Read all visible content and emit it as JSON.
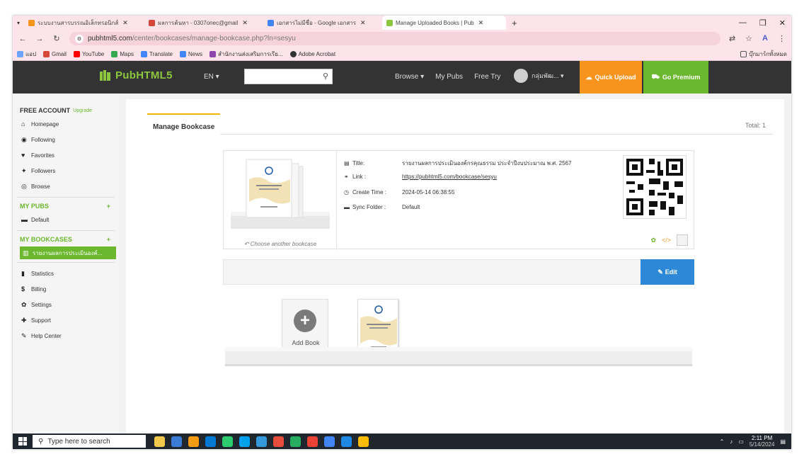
{
  "browser": {
    "tabs": [
      {
        "label": "ระบบงานสารบรรณอิเล็กทรอนิกส์",
        "color": "#f7941e"
      },
      {
        "label": "ผลการค้นหา - 0307onec@gmail",
        "color": "#d44638"
      },
      {
        "label": "เอกสารไม่มีชื่อ - Google เอกสาร",
        "color": "#4285f4"
      },
      {
        "label": "Manage Uploaded Books | Pub",
        "color": "#8dc63f",
        "active": true
      }
    ],
    "tab_close": "✕",
    "new_tab": "+",
    "url_host": "pubhtml5.com",
    "url_path": "/center/bookcases/manage-bookcase.php?ln=sesyu",
    "bookmarks": [
      {
        "label": "แอป",
        "color": "#6ba4f8"
      },
      {
        "label": "Gmail",
        "color": "#d44638"
      },
      {
        "label": "YouTube",
        "color": "#ff0000"
      },
      {
        "label": "Maps",
        "color": "#34a853"
      },
      {
        "label": "Translate",
        "color": "#4285f4"
      },
      {
        "label": "News",
        "color": "#4285f4"
      },
      {
        "label": "สำนักงานส่งเสริมการเรีย...",
        "color": "#8e44ad"
      },
      {
        "label": "Adobe Acrobat",
        "color": "#333333"
      }
    ],
    "bookmarks_other": "บุ๊กมาร์กทั้งหมด"
  },
  "site": {
    "logo": "PubHTML5",
    "lang": "EN ▾",
    "nav": [
      "Browse ▾",
      "My Pubs",
      "Free Try"
    ],
    "user_name": "กลุ่มพัฒ... ▾",
    "quick_upload": "Quick Upload",
    "go_premium": "Go Premium",
    "accent_green": "#6bb72e",
    "accent_orange": "#f7941e"
  },
  "sidebar": {
    "free_account": "FREE ACCOUNT",
    "upgrade": "Upgrade",
    "items1": [
      {
        "label": "Homepage",
        "icon": "⌂"
      },
      {
        "label": "Following",
        "icon": "◉"
      },
      {
        "label": "Favorites",
        "icon": "♥"
      },
      {
        "label": "Followers",
        "icon": "✦"
      },
      {
        "label": "Browse",
        "icon": "◎"
      }
    ],
    "my_pubs": "MY PUBS",
    "my_pubs_items": [
      {
        "label": "Default",
        "icon": "▬"
      }
    ],
    "my_bookcases": "MY BOOKCASES",
    "bookcase_item": "รายงานผลการประเมินองค์...",
    "items2": [
      {
        "label": "Statistics",
        "icon": "▮"
      },
      {
        "label": "Billing",
        "icon": "$"
      },
      {
        "label": "Settings",
        "icon": "✿"
      },
      {
        "label": "Support",
        "icon": "✚"
      },
      {
        "label": "Help Center",
        "icon": "✎"
      }
    ],
    "plus": "+"
  },
  "main": {
    "tab_label": "Manage Bookcase",
    "total": "Total: 1",
    "choose_bookcase": "Choose another bookcase",
    "title_key": "Title:",
    "title_val": "รายงานผลการประเมินองค์กรคุณธรรม ประจำปีงบประมาณ พ.ศ. 2567",
    "link_key": "Link :",
    "link_val": "https://pubhtml5.com/bookcase/sesyu",
    "create_key": "Create Time :",
    "create_val": "2024-05-14 06:38:55",
    "sync_key": "Sync Folder :",
    "sync_val": "Default",
    "edit_label": "Edit",
    "add_book": "Add Book"
  },
  "taskbar": {
    "search_placeholder": "Type here to search",
    "time": "2:11 PM",
    "date": "5/14/2024",
    "apps": [
      "#f2c94c",
      "#3a7bd5",
      "#f39c12",
      "#0078d4",
      "#2ecc71",
      "#00a2ed",
      "#3498db",
      "#e74c3c",
      "#27ae60",
      "#ea4335",
      "#4285f4",
      "#1e88e5",
      "#fbbc05"
    ]
  }
}
